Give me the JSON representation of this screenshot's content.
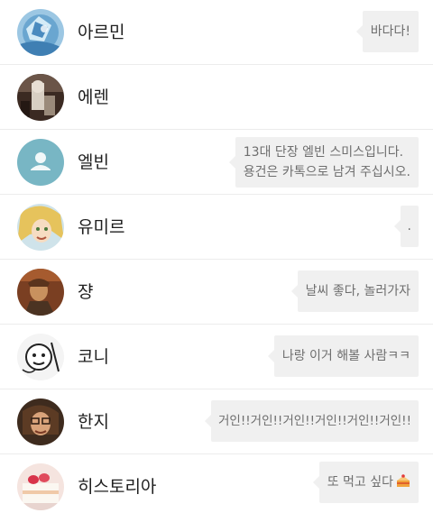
{
  "rows": [
    {
      "name": "아르민",
      "message": [
        "바다다!"
      ],
      "avatar_icon": "armin-avatar-icon",
      "avatar_color": "#7fb4d6"
    },
    {
      "name": "에렌",
      "message": [],
      "avatar_icon": "eren-avatar-icon",
      "avatar_color": "#5a3a2a"
    },
    {
      "name": "엘빈",
      "message": [
        "13대 단장 엘빈 스미스입니다.",
        "용건은 카톡으로 남겨 주십시오."
      ],
      "avatar_icon": "default-profile-icon",
      "avatar_color": "#78b6c4"
    },
    {
      "name": "유미르",
      "message": [
        "."
      ],
      "avatar_icon": "ymir-avatar-icon",
      "avatar_color": "#e7c869"
    },
    {
      "name": "쟝",
      "message": [
        "날씨 좋다, 놀러가자"
      ],
      "avatar_icon": "jean-avatar-icon",
      "avatar_color": "#8a4a2c"
    },
    {
      "name": "코니",
      "message": [
        "나랑 이거 해볼 사람ㅋㅋ"
      ],
      "avatar_icon": "connie-avatar-icon",
      "avatar_color": "#f3f3f3"
    },
    {
      "name": "한지",
      "message": [
        "거인!!거인!!거인!!거인!!거인!!거인!!"
      ],
      "avatar_icon": "hange-avatar-icon",
      "avatar_color": "#6b4a30"
    },
    {
      "name": "히스토리아",
      "message": [
        "또 먹고 싶다"
      ],
      "avatar_icon": "historia-avatar-icon",
      "avatar_color": "#f2d9d4",
      "message_emoji": "cake-icon"
    }
  ]
}
